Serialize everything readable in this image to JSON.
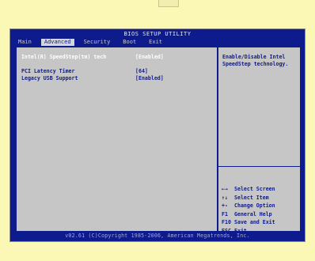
{
  "title": "BIOS SETUP UTILITY",
  "menu": [
    {
      "label": "Main",
      "active": false
    },
    {
      "label": "Advanced",
      "active": true
    },
    {
      "label": "Security",
      "active": false
    },
    {
      "label": "Boot",
      "active": false
    },
    {
      "label": "Exit",
      "active": false
    }
  ],
  "settings": [
    {
      "label": "Intel(R) SpeedStep(tm) tech",
      "value": "[Enabled]"
    },
    {
      "label": "PCI Latency Timer",
      "value": "[64]"
    },
    {
      "label": "Legacy USB Support",
      "value": "[Enabled]"
    }
  ],
  "help": {
    "line1": "Enable/Disable Intel",
    "line2": "SpeedStep technology."
  },
  "keys": [
    {
      "key": "←→",
      "desc": "Select Screen"
    },
    {
      "key": "↑↓",
      "desc": "Select Item"
    },
    {
      "key": "+-",
      "desc": "Change Option"
    },
    {
      "key": "F1",
      "desc": "General Help"
    },
    {
      "key": "F10",
      "desc": "Save and Exit"
    },
    {
      "key": "ESC",
      "desc": "Exit"
    }
  ],
  "footer": "v02.61 (C)Copyright 1985-2006, American Megatrends, Inc.",
  "colors": {
    "page_background": "#fbf7b4",
    "bios_blue": "#0e1b8c",
    "panel_gray": "#c6c6c6",
    "selected_text": "#ffffff"
  }
}
